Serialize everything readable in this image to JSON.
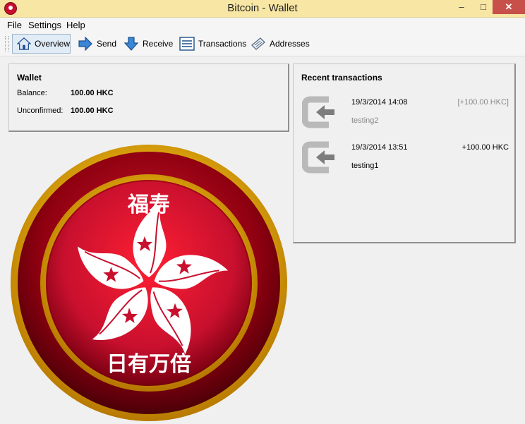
{
  "window": {
    "title": "Bitcoin - Wallet",
    "minimize": "–",
    "maximize": "□",
    "close": "✕"
  },
  "menu": [
    "File",
    "Settings",
    "Help"
  ],
  "toolbar": {
    "overview": "Overview",
    "send": "Send",
    "receive": "Receive",
    "transactions": "Transactions",
    "addresses": "Addresses"
  },
  "wallet": {
    "title": "Wallet",
    "balance_label": "Balance:",
    "balance_value": "100.00 HKC",
    "unconfirmed_label": "Unconfirmed:",
    "unconfirmed_value": "100.00 HKC"
  },
  "recent": {
    "title": "Recent transactions",
    "items": [
      {
        "date": "19/3/2014 14:08",
        "amount": "[+100.00 HKC]",
        "label": "testing2",
        "confirmed": false
      },
      {
        "date": "19/3/2014 13:51",
        "amount": "+100.00 HKC",
        "label": "testing1",
        "confirmed": true
      }
    ]
  },
  "coin": {
    "top_text": "福寿",
    "bottom_text": "日有万倍"
  },
  "colors": {
    "titlebar": "#f8e6a4",
    "close_button": "#c7504a",
    "coin_red": "#c8102e",
    "coin_gold": "#f5c518"
  }
}
